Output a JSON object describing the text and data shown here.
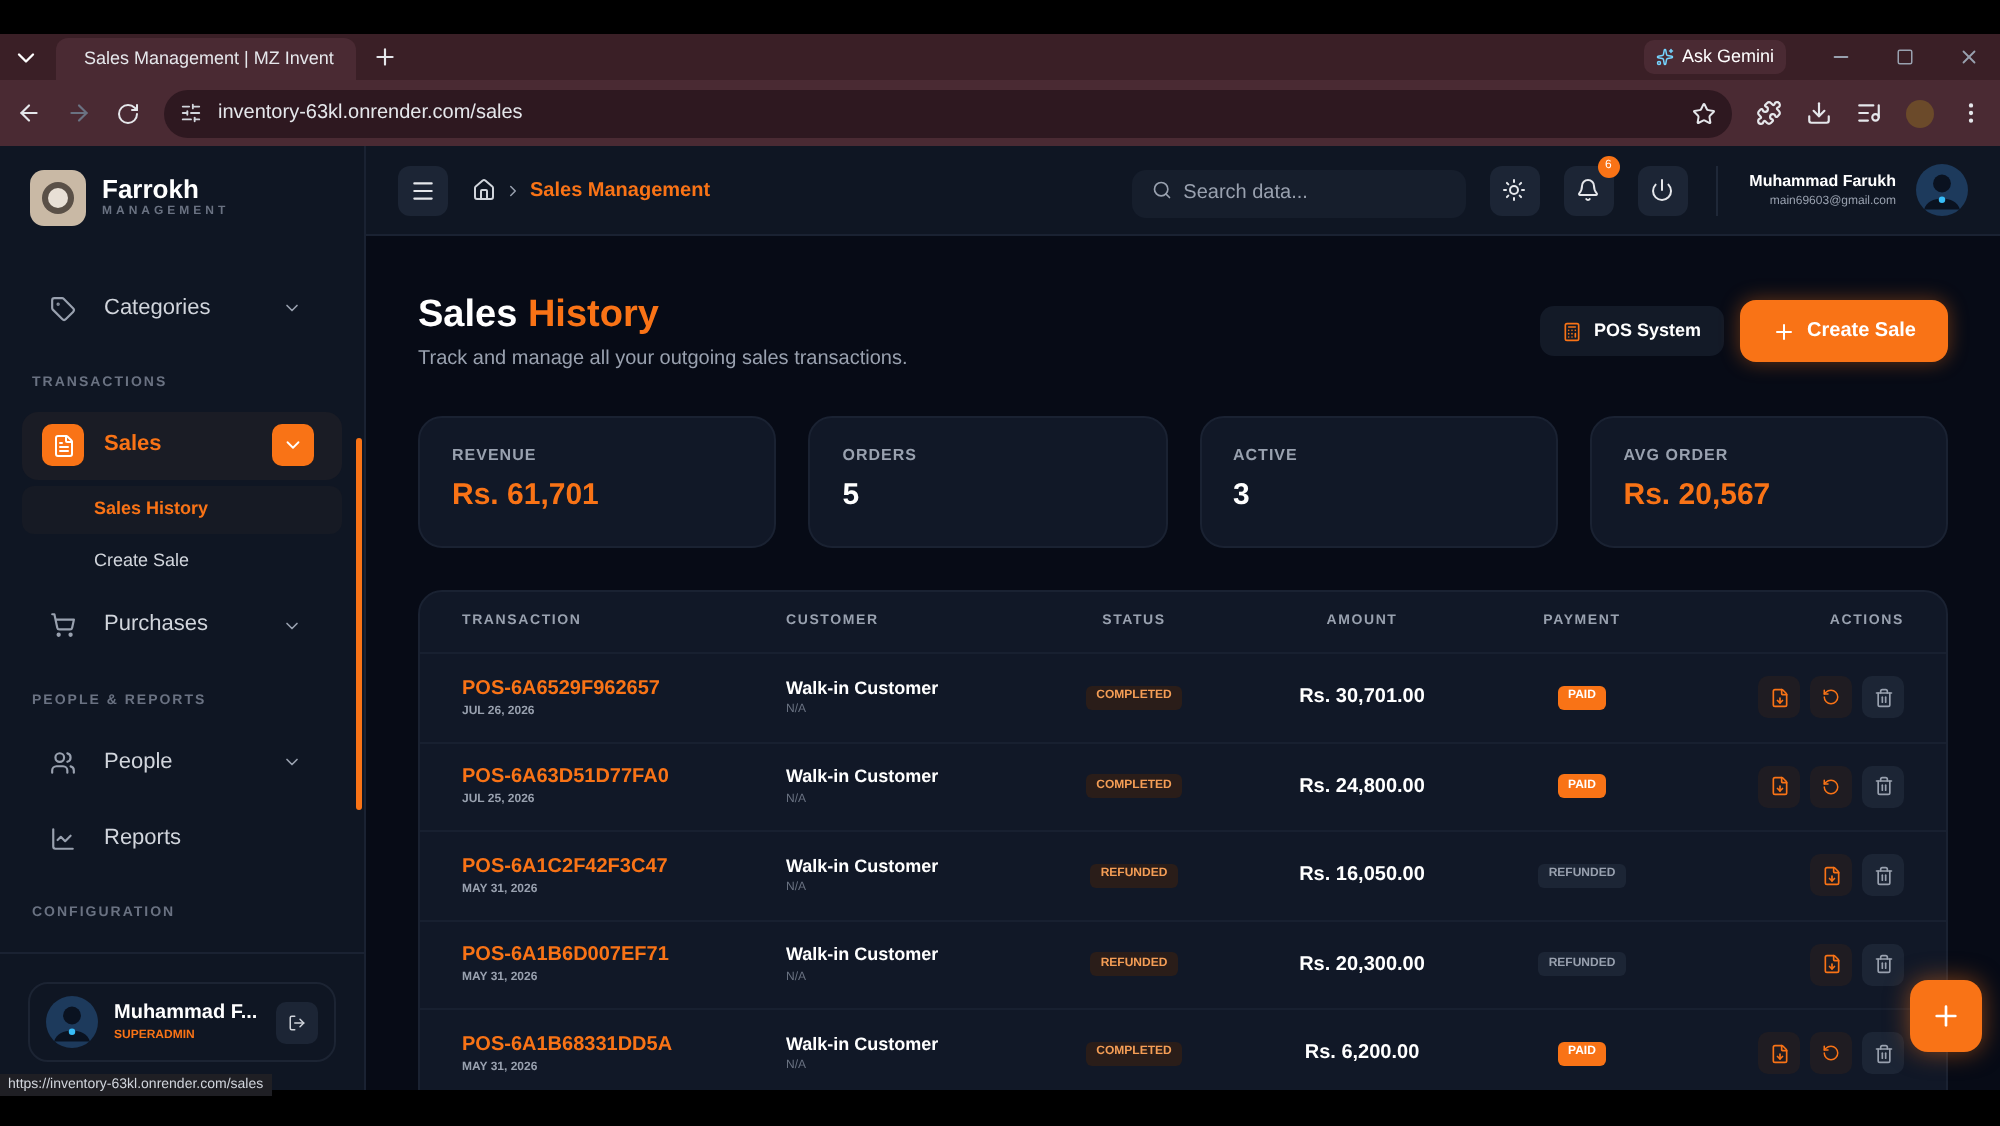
{
  "browser": {
    "tab_title": "Sales Management | MZ Invent",
    "gemini": "Ask Gemini",
    "url": "inventory-63kl.onrender.com/sales",
    "status_url": "https://inventory-63kl.onrender.com/sales"
  },
  "sidebar": {
    "brand": "Farrokh",
    "brand_sub": "MANAGEMENT",
    "sections": [
      {
        "items": [
          {
            "label": "Categories",
            "selected": false,
            "expanded": false
          }
        ]
      },
      {
        "heading": "TRANSACTIONS",
        "items": [
          {
            "label": "Sales",
            "selected": true,
            "expanded": true,
            "children": [
              {
                "label": "Sales History",
                "selected": true
              },
              {
                "label": "Create Sale",
                "selected": false
              }
            ]
          },
          {
            "label": "Purchases",
            "selected": false,
            "expanded": false
          }
        ]
      },
      {
        "heading": "PEOPLE & REPORTS",
        "items": [
          {
            "label": "People",
            "selected": false,
            "expanded": false
          },
          {
            "label": "Reports",
            "selected": false
          }
        ]
      },
      {
        "heading": "CONFIGURATION"
      }
    ],
    "user": {
      "name": "Muhammad F...",
      "role": "SUPERADMIN"
    }
  },
  "header": {
    "breadcrumb": "Sales Management",
    "search_placeholder": "Search data...",
    "notifications": "6",
    "user_name": "Muhammad Farukh",
    "user_email": "main69603@gmail.com"
  },
  "page": {
    "title": "Sales",
    "title_accent": "History",
    "subtitle": "Track and manage all your outgoing sales transactions.",
    "pos_button": "POS System",
    "create_button": "Create Sale"
  },
  "stats": [
    {
      "label": "REVENUE",
      "value": "Rs. 61,701",
      "accent": true
    },
    {
      "label": "ORDERS",
      "value": "5",
      "accent": false
    },
    {
      "label": "ACTIVE",
      "value": "3",
      "accent": false
    },
    {
      "label": "AVG ORDER",
      "value": "Rs. 20,567",
      "accent": true
    }
  ],
  "table": {
    "columns": [
      "TRANSACTION",
      "CUSTOMER",
      "STATUS",
      "AMOUNT",
      "PAYMENT",
      "ACTIONS"
    ],
    "rows": [
      {
        "id": "POS-6A6529F962657",
        "date": "JUL 26, 2026",
        "customer": "Walk-in Customer",
        "customer_sub": "N/A",
        "status": "COMPLETED",
        "amount": "Rs. 30,701.00",
        "payment": "PAID",
        "paid": true,
        "refundable": true
      },
      {
        "id": "POS-6A63D51D77FA0",
        "date": "JUL 25, 2026",
        "customer": "Walk-in Customer",
        "customer_sub": "N/A",
        "status": "COMPLETED",
        "amount": "Rs. 24,800.00",
        "payment": "PAID",
        "paid": true,
        "refundable": true
      },
      {
        "id": "POS-6A1C2F42F3C47",
        "date": "MAY 31, 2026",
        "customer": "Walk-in Customer",
        "customer_sub": "N/A",
        "status": "REFUNDED",
        "amount": "Rs. 16,050.00",
        "payment": "REFUNDED",
        "paid": false,
        "refundable": false
      },
      {
        "id": "POS-6A1B6D007EF71",
        "date": "MAY 31, 2026",
        "customer": "Walk-in Customer",
        "customer_sub": "N/A",
        "status": "REFUNDED",
        "amount": "Rs. 20,300.00",
        "payment": "REFUNDED",
        "paid": false,
        "refundable": false
      },
      {
        "id": "POS-6A1B68331DD5A",
        "date": "MAY 31, 2026",
        "customer": "Walk-in Customer",
        "customer_sub": "N/A",
        "status": "COMPLETED",
        "amount": "Rs. 6,200.00",
        "payment": "PAID",
        "paid": true,
        "refundable": true
      }
    ]
  }
}
